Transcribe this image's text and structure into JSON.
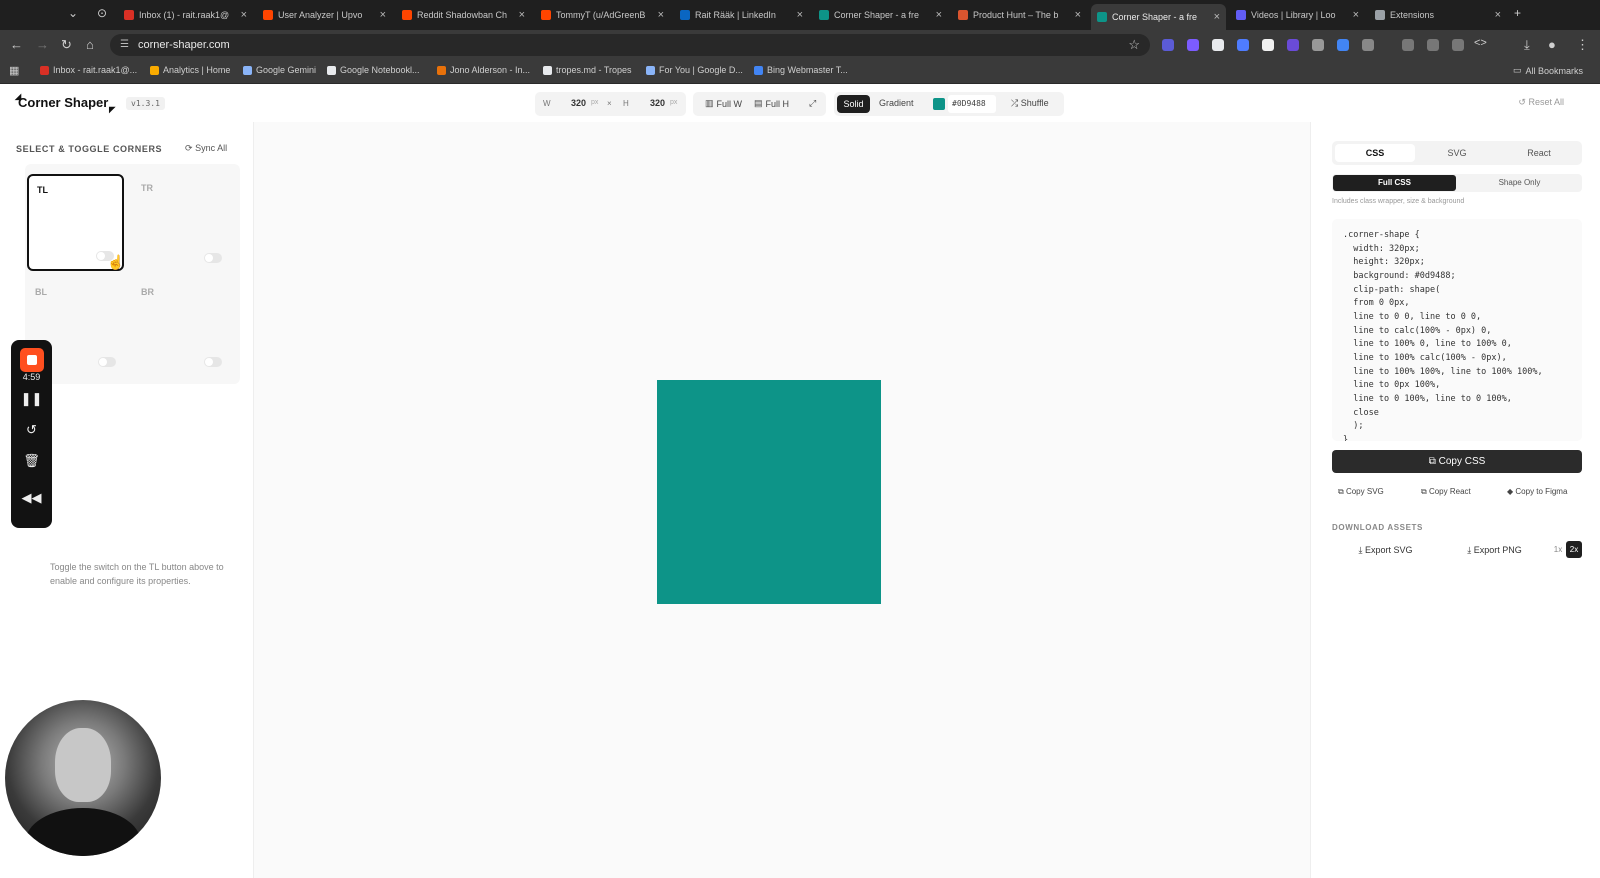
{
  "browser": {
    "tabs": [
      {
        "title": "Inbox (1) - rait.raak1@",
        "color": "#d93025"
      },
      {
        "title": "User Analyzer | Upvo",
        "color": "#ff4500"
      },
      {
        "title": "Reddit Shadowban Ch",
        "color": "#ff4500"
      },
      {
        "title": "TommyT (u/AdGreenB",
        "color": "#ff4500"
      },
      {
        "title": "Rait Rääk | LinkedIn",
        "color": "#0a66c2"
      },
      {
        "title": "Corner Shaper - a fre",
        "color": "#0d9488"
      },
      {
        "title": "Product Hunt – The b",
        "color": "#da552f"
      },
      {
        "title": "Corner Shaper - a fre",
        "color": "#0d9488"
      },
      {
        "title": "Videos | Library | Loo",
        "color": "#625df5"
      },
      {
        "title": "Extensions",
        "color": "#9aa0a6"
      }
    ],
    "active_tab": 7,
    "url": "corner-shaper.com",
    "bookmarks": [
      {
        "label": "Inbox - rait.raak1@...",
        "color": "#d93025"
      },
      {
        "label": "Analytics | Home",
        "color": "#f9ab00"
      },
      {
        "label": "Google Gemini",
        "color": "#8ab4f8"
      },
      {
        "label": "Google Notebookl...",
        "color": "#e8eaed"
      },
      {
        "label": "Jono Alderson - In...",
        "color": "#e8710a"
      },
      {
        "label": "tropes.md - Tropes",
        "color": "#e8eaed"
      },
      {
        "label": "For You | Google D...",
        "color": "#8ab4f8"
      },
      {
        "label": "Bing Webmaster T...",
        "color": "#4285f4"
      }
    ],
    "all_bookmarks": "All Bookmarks"
  },
  "header": {
    "logo": "Corner Shaper",
    "version": "v1.3.1",
    "width_label": "W",
    "width_value": "320",
    "height_label": "H",
    "height_value": "320",
    "unit": "px",
    "times": "×",
    "full_w": "Full W",
    "full_h": "Full H",
    "solid": "Solid",
    "gradient": "Gradient",
    "hex": "#0D9488",
    "shuffle": "Shuffle",
    "reset_all": "Reset All"
  },
  "left": {
    "title": "SELECT & TOGGLE CORNERS",
    "sync_all": "Sync All",
    "corners": [
      "TL",
      "TR",
      "BL",
      "BR"
    ],
    "selected_corner": "TL",
    "hint": "Toggle the switch on the TL button above to enable and configure its properties."
  },
  "recorder": {
    "time": "4:59"
  },
  "canvas": {
    "fill_color": "#0d9488"
  },
  "right": {
    "tabs": [
      "CSS",
      "SVG",
      "React"
    ],
    "active_tab": "CSS",
    "modes": [
      "Full CSS",
      "Shape Only"
    ],
    "active_mode": "Full CSS",
    "includes": "Includes class wrapper, size & background",
    "code": ".corner-shape {\n  width: 320px;\n  height: 320px;\n  background: #0d9488;\n  clip-path: shape(\n  from 0 0px,\n  line to 0 0, line to 0 0,\n  line to calc(100% - 0px) 0,\n  line to 100% 0, line to 100% 0,\n  line to 100% calc(100% - 0px),\n  line to 100% 100%, line to 100% 100%,\n  line to 0px 100%,\n  line to 0 100%, line to 0 100%,\n  close\n  );\n}",
    "copy_css": "Copy CSS",
    "copy_svg": "Copy SVG",
    "copy_react": "Copy React",
    "copy_figma": "Copy to Figma",
    "download_title": "DOWNLOAD ASSETS",
    "export_svg": "Export SVG",
    "export_png": "Export PNG",
    "scale_1x": "1x",
    "scale_2x": "2x"
  }
}
